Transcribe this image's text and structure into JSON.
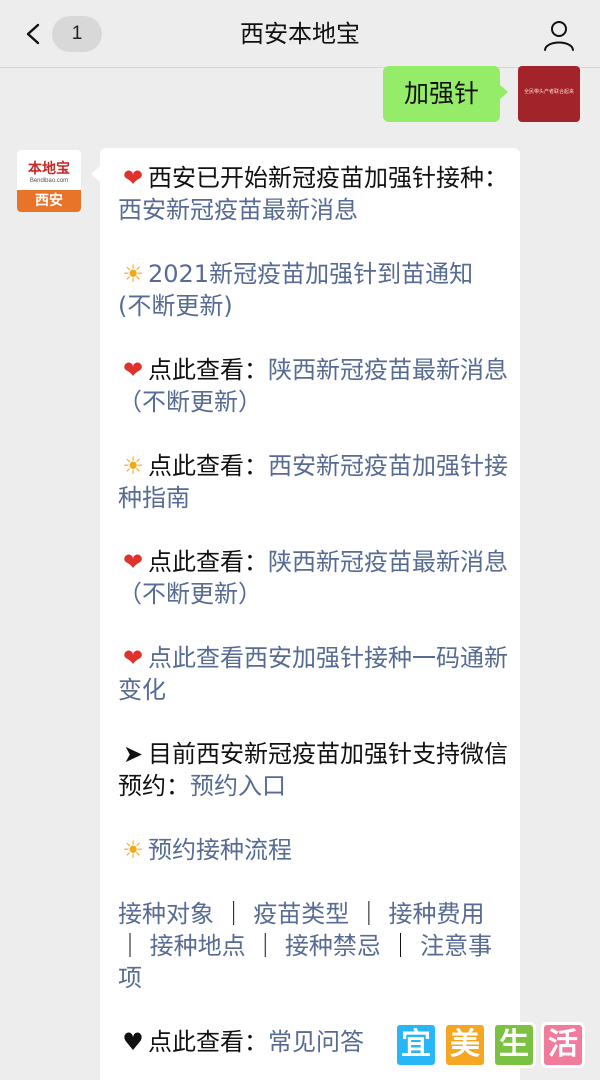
{
  "header": {
    "title": "西安本地宝",
    "unread_count": "1"
  },
  "outgoing": {
    "text": "加强针",
    "avatar_text": "全民带头产者联合起来"
  },
  "incoming": {
    "avatar_logo": "本地宝",
    "avatar_sub": "Bendibao.com",
    "avatar_city": "西安",
    "paragraphs": [
      {
        "emoji": "❤",
        "prefix": "西安已开始新冠疫苗加强针接种：",
        "link": "西安新冠疫苗最新消息"
      },
      {
        "emoji": "☀",
        "prefix": "",
        "link": "2021新冠疫苗加强针到苗通知 (不断更新)"
      },
      {
        "emoji": "❤",
        "prefix": "点此查看：",
        "link": "陕西新冠疫苗最新消息（不断更新）"
      },
      {
        "emoji": "☀",
        "prefix": "点此查看：",
        "link": "西安新冠疫苗加强针接种指南"
      },
      {
        "emoji": "❤",
        "prefix": "点此查看：",
        "link": "陕西新冠疫苗最新消息（不断更新）"
      },
      {
        "emoji": "❤",
        "prefix": "",
        "link": "点此查看西安加强针接种一码通新变化"
      },
      {
        "emoji": "➤",
        "prefix": "目前西安新冠疫苗加强针支持微信预约：",
        "link": "预约入口"
      },
      {
        "emoji": "☀",
        "prefix": "",
        "link": "预约接种流程"
      }
    ],
    "topic_links": [
      "接种对象",
      "疫苗类型",
      "接种费用",
      "接种地点",
      "接种禁忌",
      "注意事项"
    ],
    "last": {
      "emoji": "♥",
      "prefix": "点此查看：",
      "link": "常见问答"
    }
  },
  "watermark": {
    "chars": [
      "宜",
      "美",
      "生",
      "活"
    ],
    "colors": [
      "#29b6f6",
      "#f5a623",
      "#7cc242",
      "#f27a9a"
    ]
  },
  "colors": {
    "link": "#576b95",
    "bubble_out": "#95ec69",
    "background": "#ededed"
  }
}
